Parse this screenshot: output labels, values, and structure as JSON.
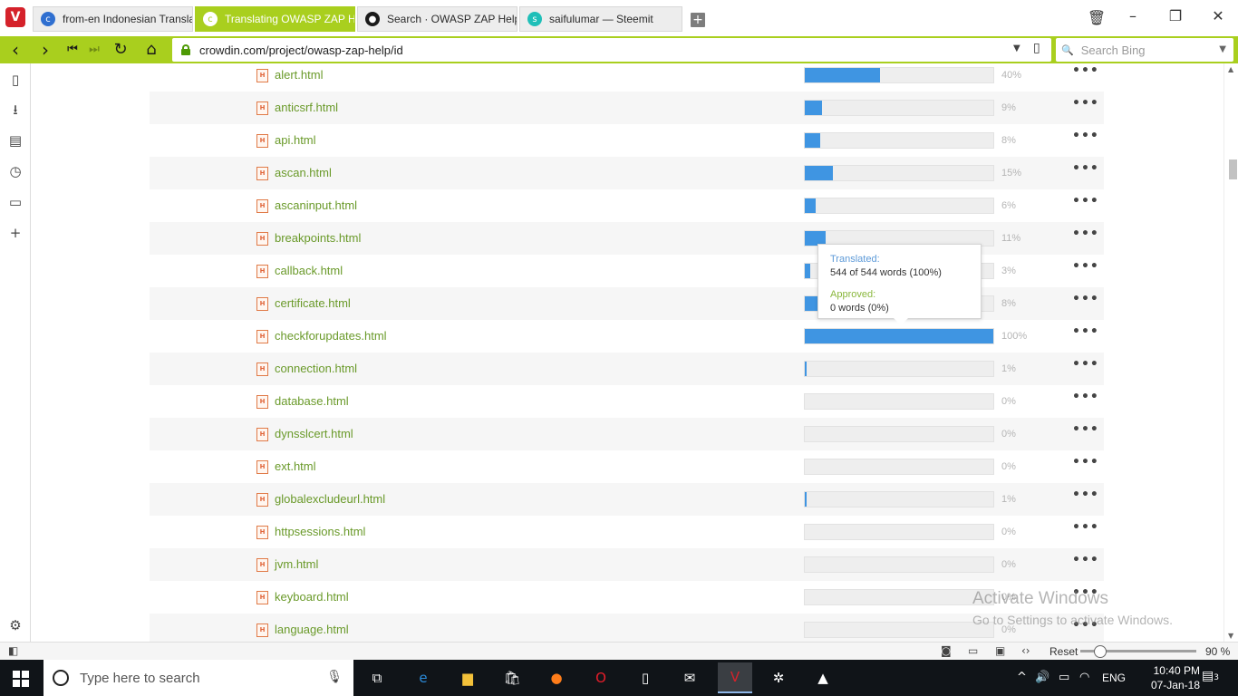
{
  "browser": {
    "tabs": [
      {
        "label": "from-en Indonesian Translat",
        "favicon": "crowdin-icon",
        "active": false
      },
      {
        "label": "Translating OWASP ZAP Help",
        "favicon": "crowdin-icon",
        "active": true
      },
      {
        "label": "Search · OWASP ZAP Help · C",
        "favicon": "github-icon",
        "active": false
      },
      {
        "label": "saifulumar — Steemit",
        "favicon": "steemit-icon",
        "active": false
      }
    ],
    "url": "crowdin.com/project/owasp-zap-help/id",
    "search_placeholder": "Search Bing",
    "accent_color": "#a9cf1e"
  },
  "files": [
    {
      "name": "alert.html",
      "percent": 40,
      "percent_label": "40%"
    },
    {
      "name": "anticsrf.html",
      "percent": 9,
      "percent_label": "9%"
    },
    {
      "name": "api.html",
      "percent": 8,
      "percent_label": "8%"
    },
    {
      "name": "ascan.html",
      "percent": 15,
      "percent_label": "15%"
    },
    {
      "name": "ascaninput.html",
      "percent": 6,
      "percent_label": "6%"
    },
    {
      "name": "breakpoints.html",
      "percent": 11,
      "percent_label": "11%"
    },
    {
      "name": "callback.html",
      "percent": 3,
      "percent_label": "3%"
    },
    {
      "name": "certificate.html",
      "percent": 8,
      "percent_label": "8%"
    },
    {
      "name": "checkforupdates.html",
      "percent": 100,
      "percent_label": "100%"
    },
    {
      "name": "connection.html",
      "percent": 1,
      "percent_label": "1%"
    },
    {
      "name": "database.html",
      "percent": 0,
      "percent_label": "0%"
    },
    {
      "name": "dynsslcert.html",
      "percent": 0,
      "percent_label": "0%"
    },
    {
      "name": "ext.html",
      "percent": 0,
      "percent_label": "0%"
    },
    {
      "name": "globalexcludeurl.html",
      "percent": 1,
      "percent_label": "1%"
    },
    {
      "name": "httpsessions.html",
      "percent": 0,
      "percent_label": "0%"
    },
    {
      "name": "jvm.html",
      "percent": 0,
      "percent_label": "0%"
    },
    {
      "name": "keyboard.html",
      "percent": 0,
      "percent_label": "0%"
    },
    {
      "name": "language.html",
      "percent": 0,
      "percent_label": "0%"
    }
  ],
  "more_label": "•••",
  "tooltip": {
    "translated_label": "Translated:",
    "translated_value": "544 of 544 words (100%)",
    "approved_label": "Approved:",
    "approved_value": "0 words (0%)"
  },
  "watermark": {
    "line1": "Activate Windows",
    "line2": "Go to Settings to activate Windows."
  },
  "statusbar": {
    "reset_label": "Reset",
    "zoom": "90 %"
  },
  "taskbar": {
    "search_placeholder": "Type here to search",
    "language": "ENG",
    "time": "10:40 PM",
    "date": "07-Jan-18",
    "notifications": "3"
  },
  "colors": {
    "progress_fill": "#3f95e2",
    "file_link": "#6a9a2a"
  }
}
